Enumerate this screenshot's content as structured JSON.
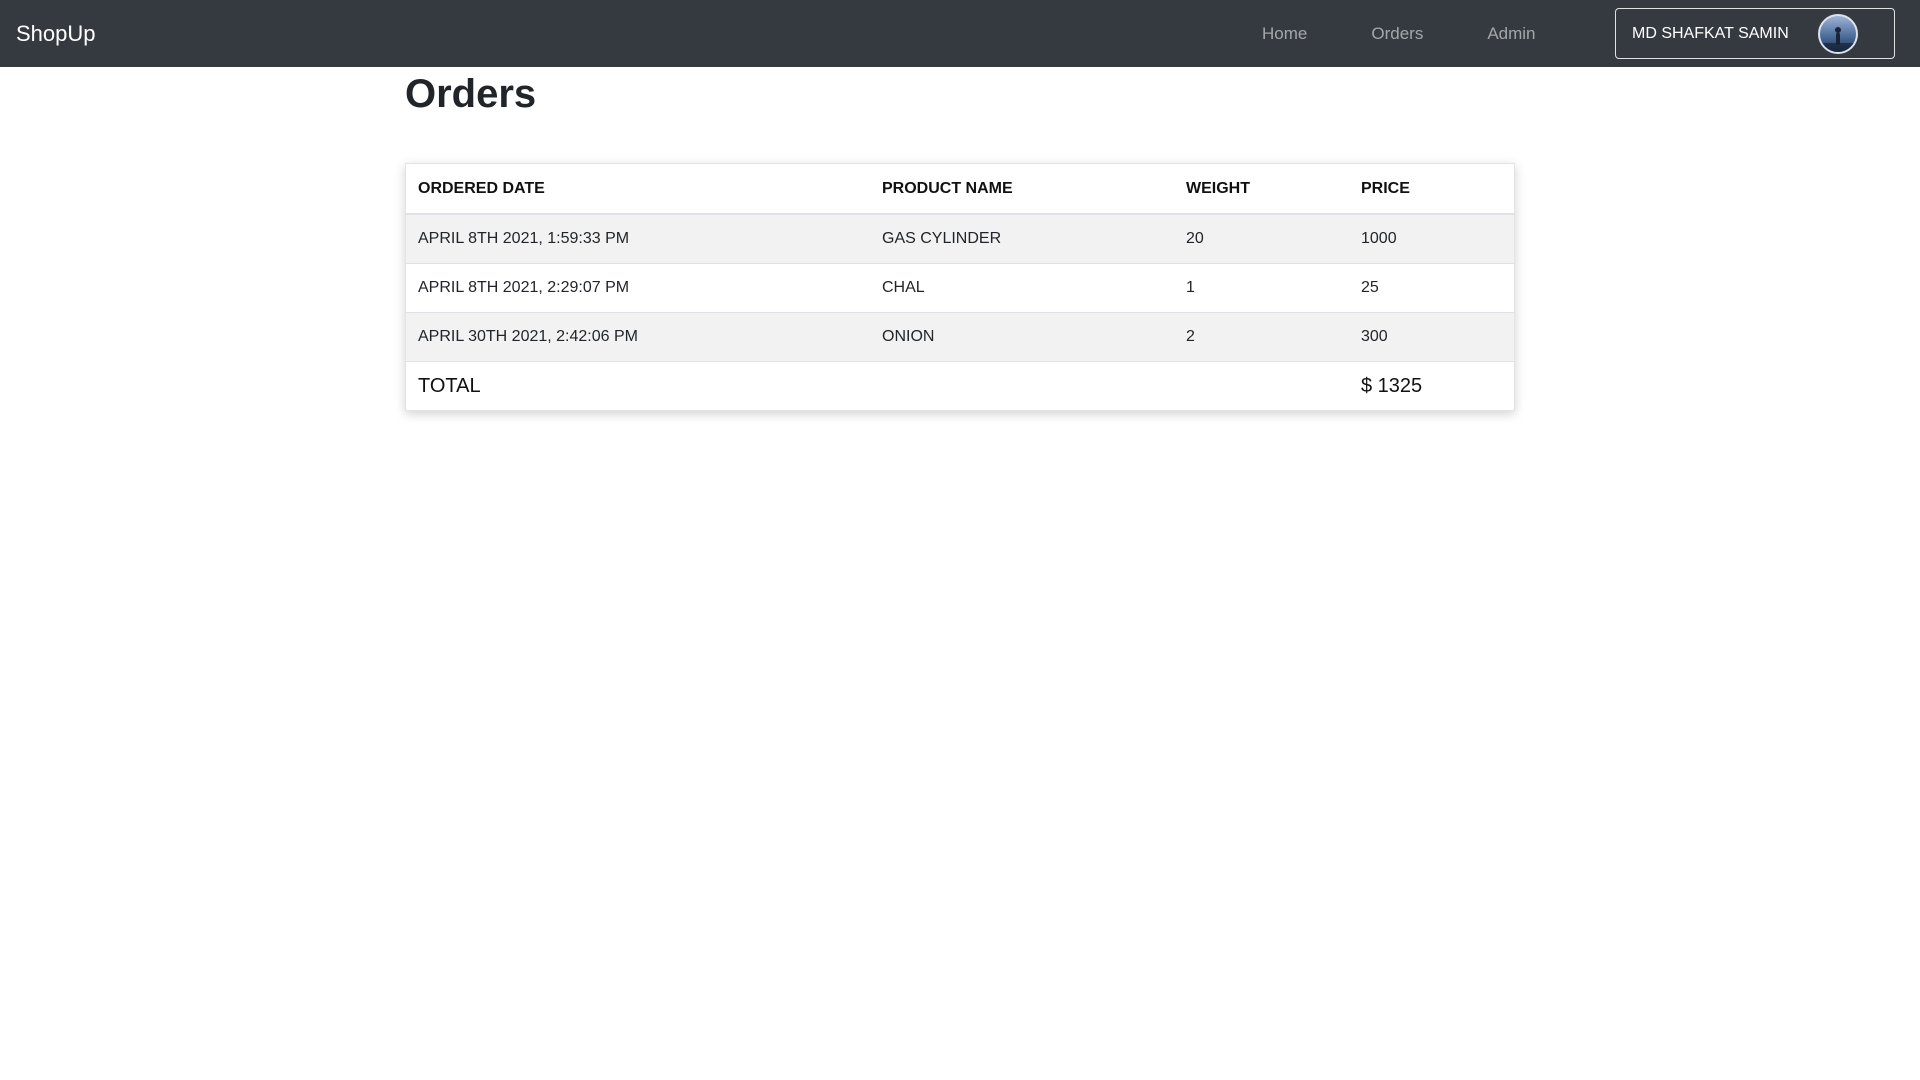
{
  "brand": "ShopUp",
  "nav": {
    "links": [
      "Home",
      "Orders",
      "Admin"
    ]
  },
  "user": {
    "name": "MD SHAFKAT SAMIN",
    "avatar_icon": "user-avatar-photo"
  },
  "page": {
    "title": "Orders"
  },
  "orders_table": {
    "headers": [
      "ORDERED DATE",
      "PRODUCT NAME",
      "WEIGHT",
      "PRICE"
    ],
    "rows": [
      [
        "APRIL 8TH 2021, 1:59:33 PM",
        "GAS CYLINDER",
        "20",
        "1000"
      ],
      [
        "APRIL 8TH 2021, 2:29:07 PM",
        "CHAL",
        "1",
        "25"
      ],
      [
        "APRIL 30TH 2021, 2:42:06 PM",
        "ONION",
        "2",
        "300"
      ]
    ],
    "total_label": "TOTAL",
    "total_value": "$ 1325"
  },
  "colors": {
    "navbar": "#343a40",
    "stripe": "#f2f2f2"
  }
}
